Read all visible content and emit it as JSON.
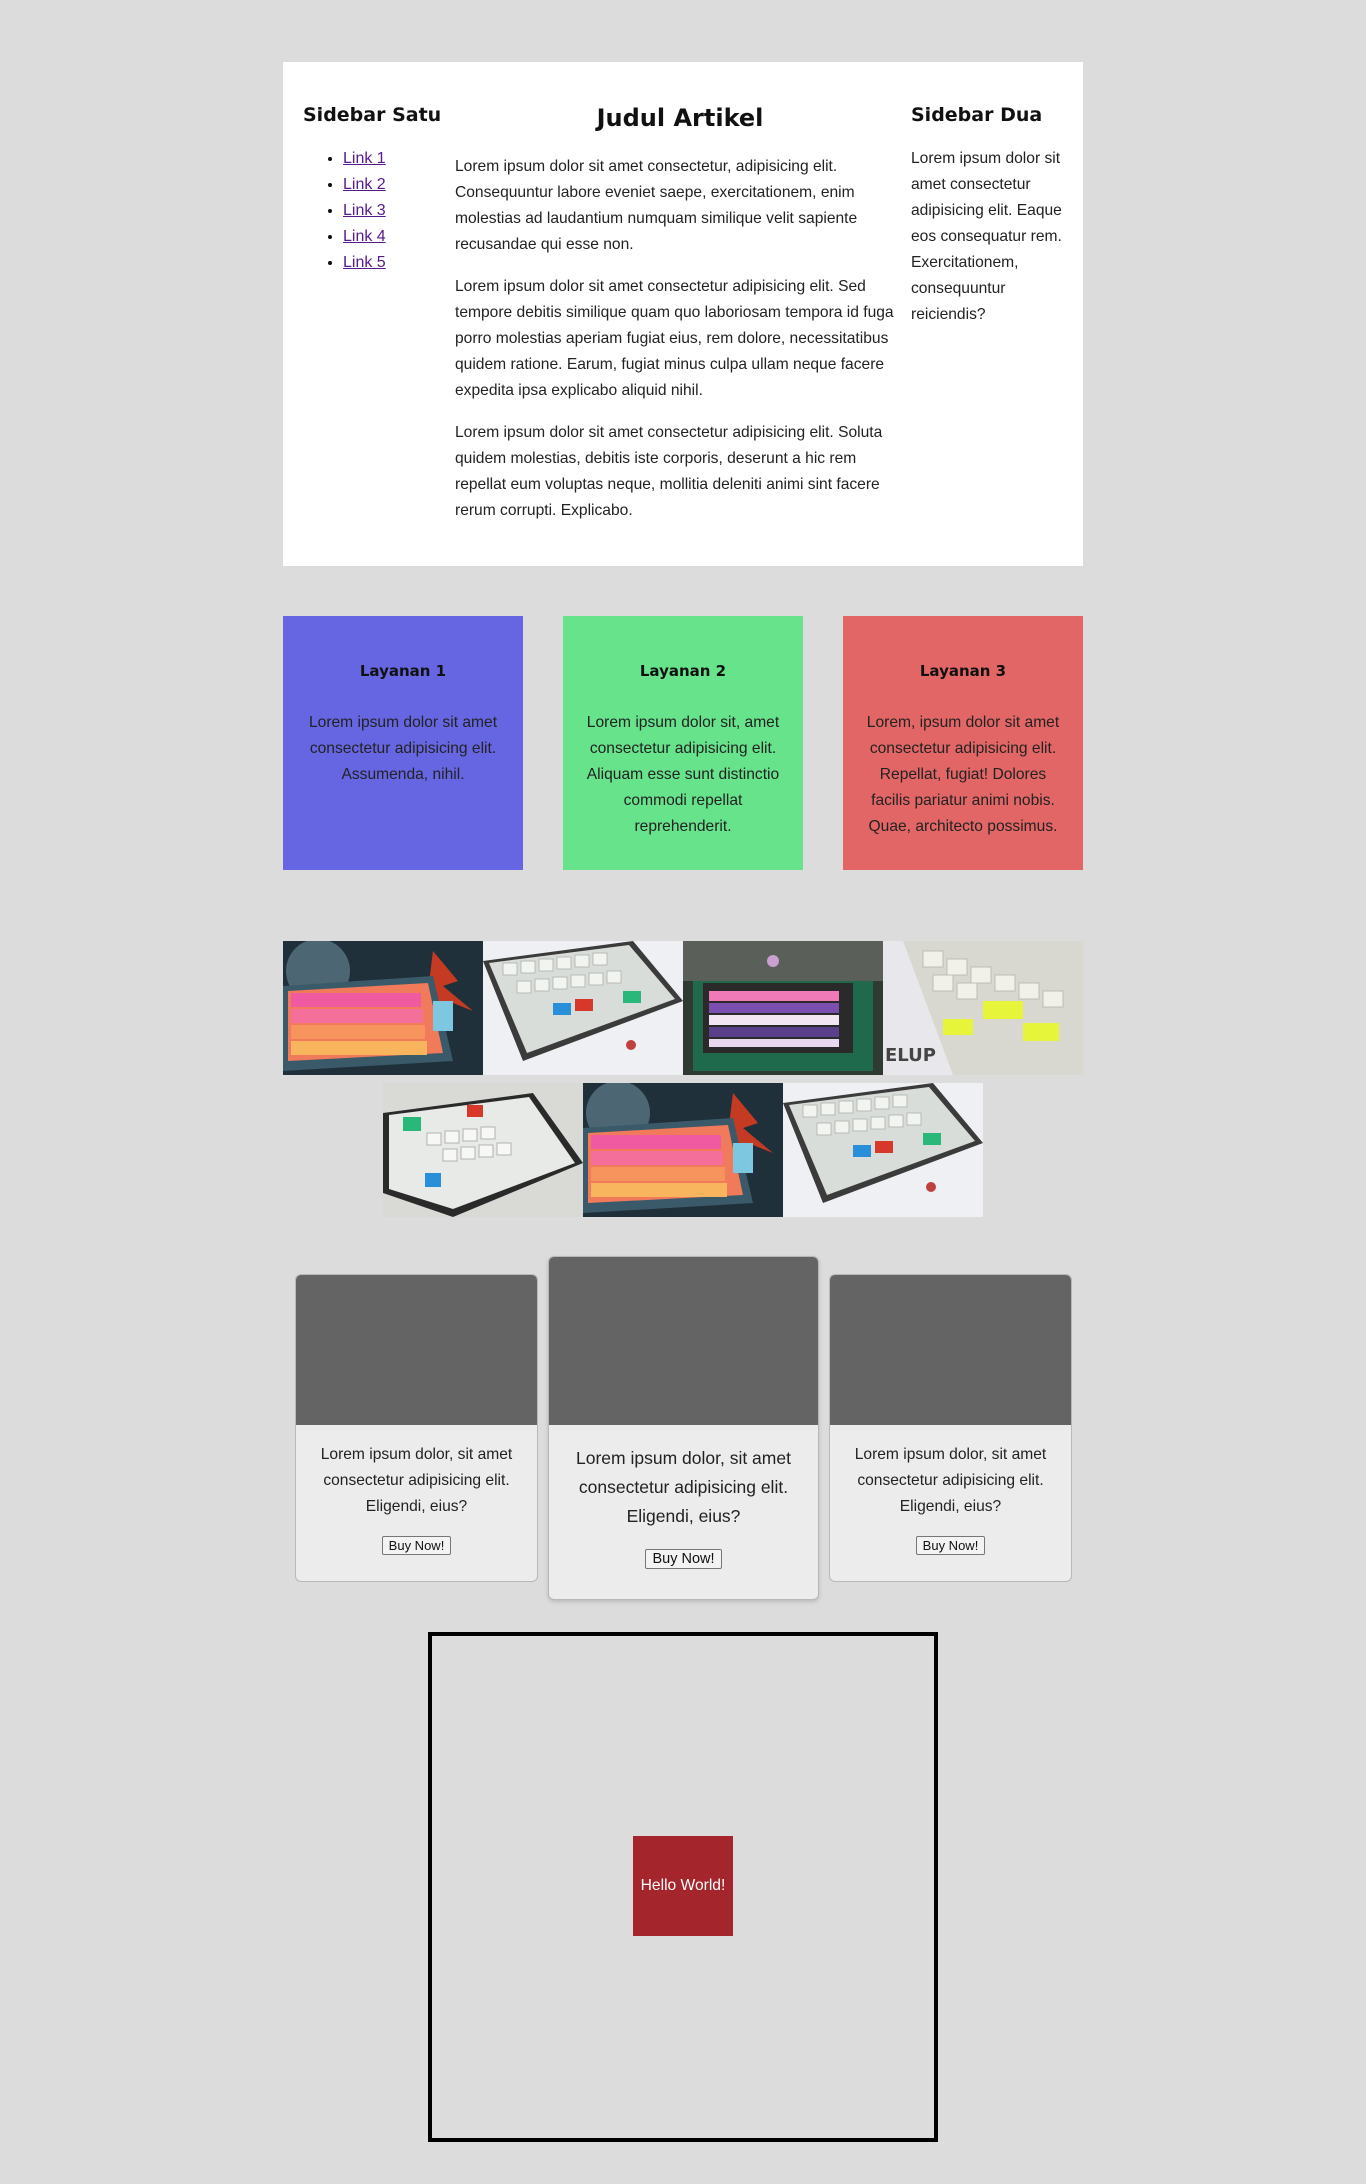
{
  "article_section": {
    "sidebar_left": {
      "title": "Sidebar Satu",
      "links": [
        "Link 1",
        "Link 2",
        "Link 3",
        "Link 4",
        "Link 5"
      ]
    },
    "main": {
      "title": "Judul Artikel",
      "paragraphs": [
        "Lorem ipsum dolor sit amet consectetur, adipisicing elit. Consequuntur labore eveniet saepe, exercitationem, enim molestias ad laudantium numquam similique velit sapiente recusandae qui esse non.",
        "Lorem ipsum dolor sit amet consectetur adipisicing elit. Sed tempore debitis similique quam quo laboriosam tempora id fuga porro molestias aperiam fugiat eius, rem dolore, necessitatibus quidem ratione. Earum, fugiat minus culpa ullam neque facere expedita ipsa explicabo aliquid nihil.",
        "Lorem ipsum dolor sit amet consectetur adipisicing elit. Soluta quidem molestias, debitis iste corporis, deserunt a hic rem repellat eum voluptas neque, mollitia deleniti animi sint facere rerum corrupti. Explicabo."
      ]
    },
    "sidebar_right": {
      "title": "Sidebar Dua",
      "text": "Lorem ipsum dolor sit amet consectetur adipisicing elit. Eaque eos consequatur rem. Exercitationem, consequuntur reiciendis?"
    }
  },
  "services": [
    {
      "title": "Layanan 1",
      "text": "Lorem ipsum dolor sit amet consectetur adipisicing elit. Assumenda, nihil.",
      "color": "#6666e3"
    },
    {
      "title": "Layanan 2",
      "text": "Lorem ipsum dolor sit, amet consectetur adipisicing elit. Aliquam esse sunt distinctio commodi repellat reprehenderit.",
      "color": "#66e38b"
    },
    {
      "title": "Layanan 3",
      "text": "Lorem, ipsum dolor sit amet consectetur adipisicing elit. Repellat, fugiat! Dolores facilis pariatur animi nobis. Quae, architecto possimus.",
      "color": "#e36666"
    }
  ],
  "gallery": {
    "images": [
      {
        "name": "keyboard-pink-orange"
      },
      {
        "name": "keyboard-white-bluegreen"
      },
      {
        "name": "keyboard-purple-pink"
      },
      {
        "name": "keyboard-white-yellow"
      },
      {
        "name": "keyboard-white-green-fur"
      },
      {
        "name": "keyboard-pink-orange"
      },
      {
        "name": "keyboard-white-bluegreen"
      }
    ]
  },
  "products": [
    {
      "text": "Lorem ipsum dolor, sit amet consectetur adipisicing elit. Eligendi, eius?",
      "button": "Buy Now!"
    },
    {
      "text": "Lorem ipsum dolor, sit amet consectetur adipisicing elit. Eligendi, eius?",
      "button": "Buy Now!"
    },
    {
      "text": "Lorem ipsum dolor, sit amet consectetur adipisicing elit. Eligendi, eius?",
      "button": "Buy Now!"
    }
  ],
  "center_box": {
    "text": "Hello World!"
  },
  "colors": {
    "page_bg": "#dcdcdc",
    "card_image": "#646464",
    "hello_bg": "#a4262c"
  }
}
